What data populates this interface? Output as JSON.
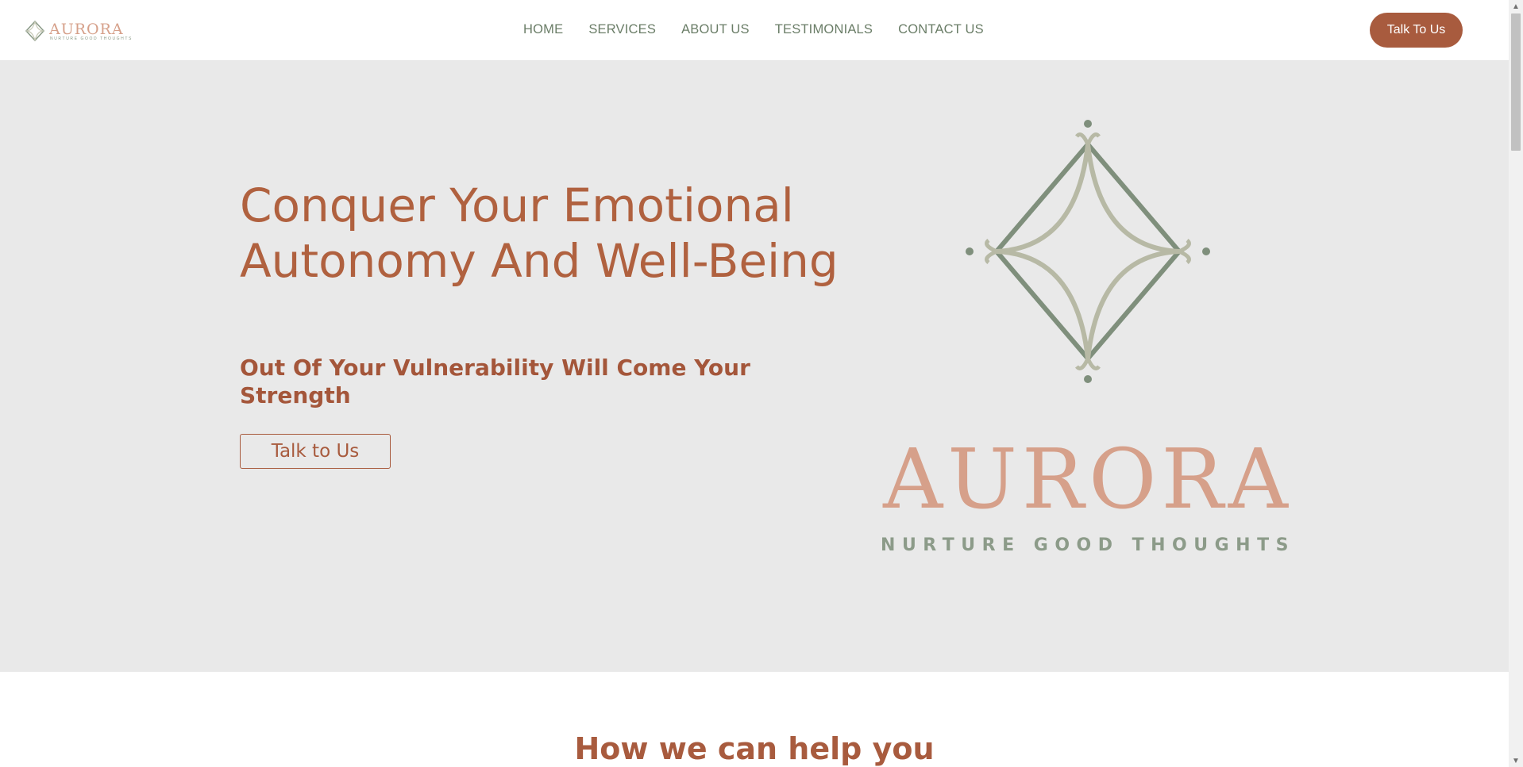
{
  "brand": {
    "name": "AURORA",
    "tagline": "NURTURE GOOD THOUGHTS",
    "colors": {
      "accent": "#a85b3e",
      "wordmark": "#d6a08a",
      "sage": "#7f8f7c",
      "hero_bg": "#e9e9e9"
    }
  },
  "nav": {
    "items": [
      {
        "label": "HOME"
      },
      {
        "label": "SERVICES"
      },
      {
        "label": "ABOUT US"
      },
      {
        "label": "TESTIMONIALS"
      },
      {
        "label": "CONTACT US"
      }
    ],
    "cta_label": "Talk To Us"
  },
  "hero": {
    "title": "Conquer Your Emotional Autonomy And Well-Being",
    "subtitle": "Out Of Your Vulnerability Will Come Your Strength",
    "cta_label": "Talk to Us"
  },
  "section": {
    "title": "How we can help you"
  },
  "icons": {
    "logo_mark": "diamond-ornament-icon",
    "scroll_up": "arrow-up-icon",
    "scroll_down": "arrow-down-icon"
  }
}
